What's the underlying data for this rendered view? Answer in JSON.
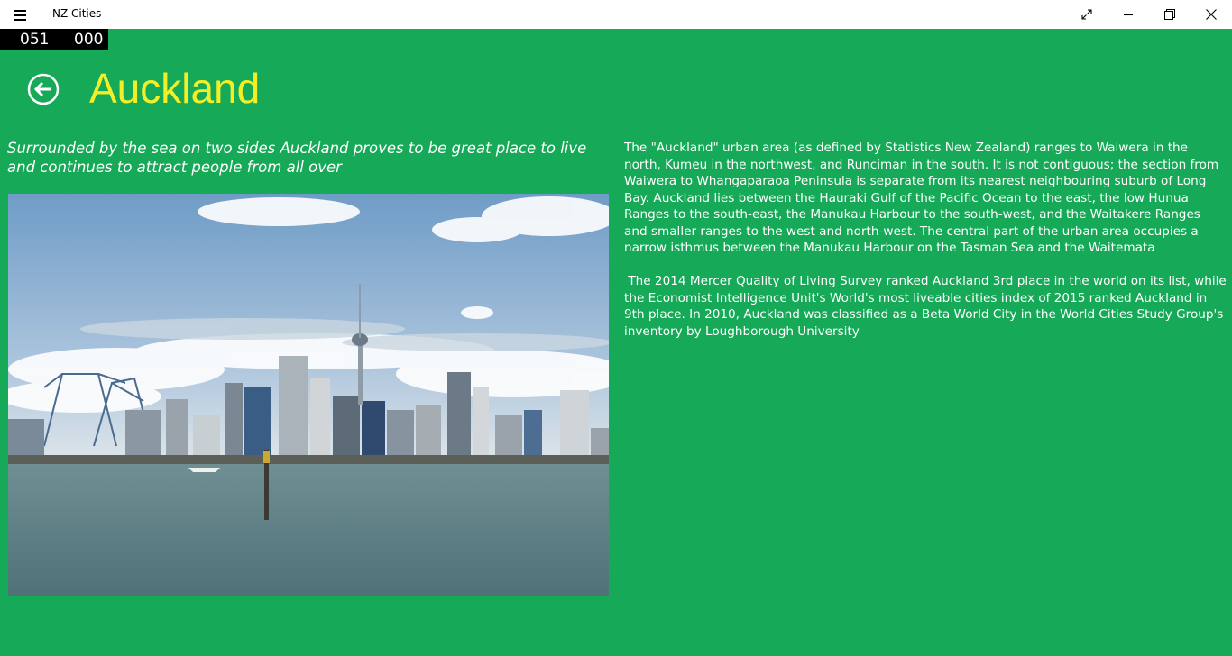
{
  "window": {
    "title": "NZ Cities",
    "controls": {
      "fullscreen_icon": "expand-icon",
      "minimize_icon": "minimize-icon",
      "restore_icon": "restore-icon",
      "close_icon": "close-icon"
    }
  },
  "counter": {
    "left": "051",
    "right": "000"
  },
  "header": {
    "back_icon": "back-arrow-icon",
    "title": "Auckland",
    "title_color": "#f2ef28"
  },
  "content": {
    "subtitle": "Surrounded by the sea on two sides Auckland proves to be great place to live and continues to attract people from all over",
    "image_icon": "auckland-skyline-photo",
    "paragraphs": [
      "The \"Auckland\" urban area (as defined by Statistics New Zealand) ranges to Waiwera in the north, Kumeu in the northwest, and Runciman in the south. It is not contiguous; the section from Waiwera to Whangaparaoa Peninsula is separate from its nearest neighbouring suburb of Long Bay. Auckland lies between the Hauraki Gulf of the Pacific Ocean to the east, the low Hunua Ranges to the south-east, the Manukau Harbour to the south-west, and the Waitakere Ranges and smaller ranges to the west and north-west. The central part of the urban area occupies a narrow isthmus between the Manukau Harbour on the Tasman Sea and the Waitemata",
      " The 2014 Mercer Quality of Living Survey ranked Auckland 3rd place in the world on its list, while the Economist Intelligence Unit's World's most liveable cities index of 2015 ranked Auckland in 9th place. In 2010, Auckland was classified as a Beta World City in the World Cities Study Group's inventory by Loughborough University"
    ]
  },
  "colors": {
    "background": "#16a957",
    "titlebar": "#ffffff",
    "text": "#ffffff"
  }
}
